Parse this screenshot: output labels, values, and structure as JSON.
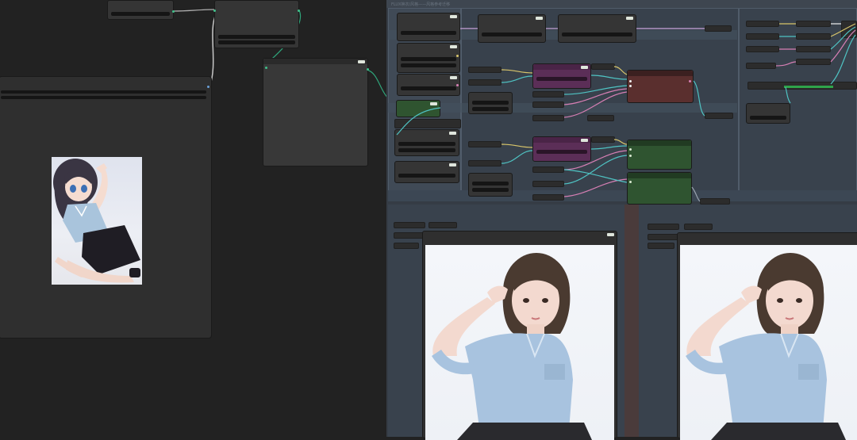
{
  "workflow": {
    "right_group_title": "FLUX换衣/风格——风格参考迁移"
  },
  "colors": {
    "canvas": "#222222",
    "group": "#3d4652",
    "node": "#353535",
    "node_green": "#2f5430",
    "node_purple": "#5b2e57",
    "node_red": "#5a2f2e",
    "link_cyan": "#4fc3c3",
    "link_pink": "#d77fb4",
    "link_yellow": "#d8c56a"
  },
  "icons": {
    "preview_original": "anime-girl-illustration",
    "preview_result_1": "realistic-girl-photo",
    "preview_result_2": "realistic-girl-photo"
  }
}
